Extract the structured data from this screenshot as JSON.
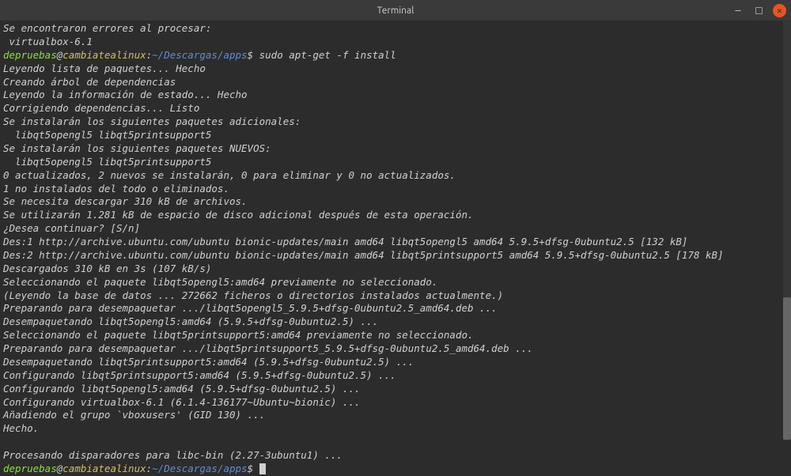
{
  "titlebar": {
    "title": "Terminal"
  },
  "prompt": {
    "user": "depruebas",
    "at": "@",
    "host": "cambiatealinux",
    "colon": ":",
    "path": "~/Descargas/apps",
    "dollar": "$",
    "command1": " sudo apt-get -f install",
    "command2": " "
  },
  "output": {
    "l00": "Se encontraron errores al procesar:",
    "l01": " virtualbox-6.1",
    "l03": "Leyendo lista de paquetes... Hecho",
    "l04": "Creando árbol de dependencias",
    "l05": "Leyendo la información de estado... Hecho",
    "l06": "Corrigiendo dependencias... Listo",
    "l07": "Se instalarán los siguientes paquetes adicionales:",
    "l08": "  libqt5opengl5 libqt5printsupport5",
    "l09": "Se instalarán los siguientes paquetes NUEVOS:",
    "l10": "  libqt5opengl5 libqt5printsupport5",
    "l11": "0 actualizados, 2 nuevos se instalarán, 0 para eliminar y 0 no actualizados.",
    "l12": "1 no instalados del todo o eliminados.",
    "l13": "Se necesita descargar 310 kB de archivos.",
    "l14": "Se utilizarán 1.281 kB de espacio de disco adicional después de esta operación.",
    "l15": "¿Desea continuar? [S/n]",
    "l16": "Des:1 http://archive.ubuntu.com/ubuntu bionic-updates/main amd64 libqt5opengl5 amd64 5.9.5+dfsg-0ubuntu2.5 [132 kB]",
    "l17": "Des:2 http://archive.ubuntu.com/ubuntu bionic-updates/main amd64 libqt5printsupport5 amd64 5.9.5+dfsg-0ubuntu2.5 [178 kB]",
    "l18": "Descargados 310 kB en 3s (107 kB/s)",
    "l19": "Seleccionando el paquete libqt5opengl5:amd64 previamente no seleccionado.",
    "l20": "(Leyendo la base de datos ... 272662 ficheros o directorios instalados actualmente.)",
    "l21": "Preparando para desempaquetar .../libqt5opengl5_5.9.5+dfsg-0ubuntu2.5_amd64.deb ...",
    "l22": "Desempaquetando libqt5opengl5:amd64 (5.9.5+dfsg-0ubuntu2.5) ...",
    "l23": "Seleccionando el paquete libqt5printsupport5:amd64 previamente no seleccionado.",
    "l24": "Preparando para desempaquetar .../libqt5printsupport5_5.9.5+dfsg-0ubuntu2.5_amd64.deb ...",
    "l25": "Desempaquetando libqt5printsupport5:amd64 (5.9.5+dfsg-0ubuntu2.5) ...",
    "l26": "Configurando libqt5printsupport5:amd64 (5.9.5+dfsg-0ubuntu2.5) ...",
    "l27": "Configurando libqt5opengl5:amd64 (5.9.5+dfsg-0ubuntu2.5) ...",
    "l28": "Configurando virtualbox-6.1 (6.1.4-136177~Ubuntu~bionic) ...",
    "l29": "Añadiendo el grupo `vboxusers' (GID 130) ...",
    "l30": "Hecho.",
    "l31": "Procesando disparadores para libc-bin (2.27-3ubuntu1) ..."
  }
}
